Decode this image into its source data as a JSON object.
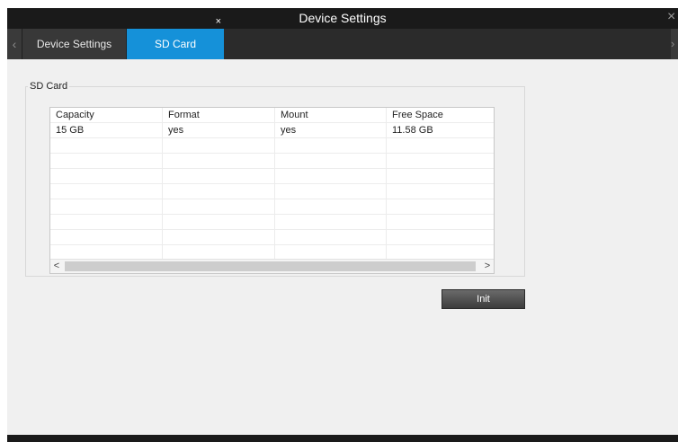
{
  "window": {
    "title": "Device Settings",
    "close_icon": "close-icon"
  },
  "tabs": [
    {
      "label": "Device Settings",
      "active": false
    },
    {
      "label": "SD Card",
      "active": true,
      "close_glyph": "×"
    }
  ],
  "nav": {
    "left_glyph": "‹",
    "right_glyph": "›"
  },
  "group": {
    "legend": "SD Card"
  },
  "table": {
    "columns": [
      "Capacity",
      "Format",
      "Mount",
      "Free Space"
    ],
    "rows": [
      [
        "15 GB",
        "yes",
        "yes",
        "11.58 GB"
      ]
    ]
  },
  "scrollbar": {
    "left_glyph": "<",
    "right_glyph": ">"
  },
  "buttons": {
    "init_label": "Init"
  },
  "colors": {
    "accent": "#1591d9",
    "titlebar": "#1a1a1a",
    "tabbar": "#2b2b2b",
    "panel": "#f0f0f0"
  }
}
